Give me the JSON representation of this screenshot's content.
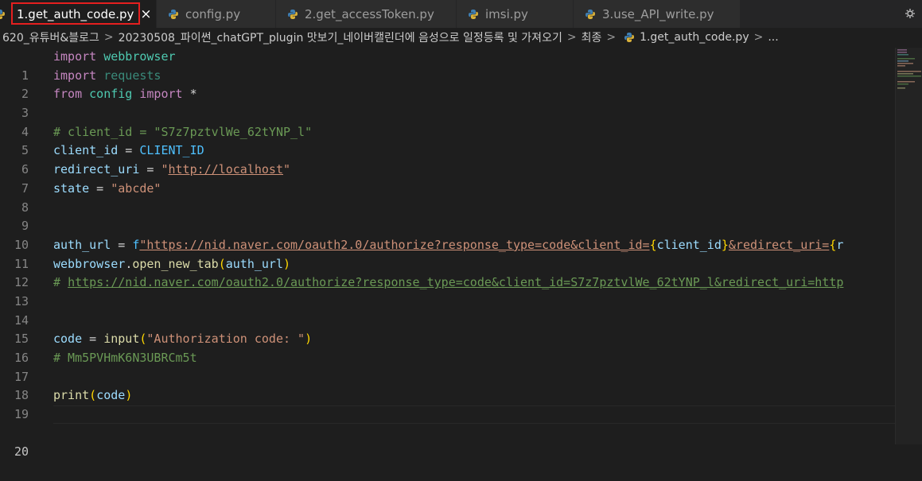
{
  "colors": {
    "background": "#1e1e1e",
    "tab_active_outline": "#e51f1f",
    "python_blue": "#3f7fb3",
    "python_yellow": "#d9b13a"
  },
  "tabs": [
    {
      "label": "1.get_auth_code.py",
      "icon": "python-icon",
      "active": true,
      "close": "×"
    },
    {
      "label": "config.py",
      "icon": "python-icon"
    },
    {
      "label": "2.get_accessToken.py",
      "icon": "python-icon"
    },
    {
      "label": "imsi.py",
      "icon": "python-icon"
    },
    {
      "label": "3.use_API_write.py",
      "icon": "python-icon"
    }
  ],
  "tabbar_action_icon": "settings-gear-icon",
  "breadcrumb": {
    "items": [
      "620_유튜버&블로그",
      "20230508_파이썬_chatGPT_plugin 맛보기_네이버캘린더에 음성으로 일정등록 및 가져오기",
      "최종",
      "1.get_auth_code.py",
      "..."
    ],
    "separator": ">"
  },
  "editor": {
    "current_line": 20,
    "line_numbers": [
      "1",
      "2",
      "3",
      "4",
      "5",
      "6",
      "7",
      "8",
      "9",
      "10",
      "11",
      "12",
      "13",
      "14",
      "15",
      "16",
      "17",
      "18",
      "19",
      "20"
    ],
    "code": {
      "l1": {
        "kw": "import",
        "mod": "webbrowser"
      },
      "l2": {
        "kw": "import",
        "mod": "requests"
      },
      "l3": {
        "kw_from": "from",
        "mod": "config",
        "kw_import": "import",
        "star": "*"
      },
      "l5": {
        "comment": "# client_id = \"S7z7pztvlWe_62tYNP_l\""
      },
      "l6": {
        "var": "client_id",
        "eq": " = ",
        "const": "CLIENT_ID"
      },
      "l7": {
        "var": "redirect_uri",
        "eq": " = ",
        "q1": "\"",
        "url": "http://localhost",
        "q2": "\""
      },
      "l8": {
        "var": "state",
        "eq": " = ",
        "str": "\"abcde\""
      },
      "l11": {
        "var": "auth_url",
        "eq": " = ",
        "prefix": "f",
        "s1": "\"https://nid.naver.com/oauth2.0/authorize?response_type=code&client_id=",
        "b1": "{",
        "v1": "client_id",
        "b2": "}",
        "s2": "&redirect_uri=",
        "b3": "{",
        "v2": "r"
      },
      "l12": {
        "obj": "webbrowser",
        "dot": ".",
        "fn": "open_new_tab",
        "p1": "(",
        "arg": "auth_url",
        "p2": ")"
      },
      "l13": {
        "hash": "# ",
        "url": "https://nid.naver.com/oauth2.0/authorize?response_type=code&client_id=S7z7pztvlWe_62tYNP_l&redirect_uri=http"
      },
      "l16": {
        "var": "code",
        "eq": " = ",
        "fn": "input",
        "p1": "(",
        "str": "\"Authorization code: \"",
        "p2": ")"
      },
      "l17": {
        "comment": "# Mm5PVHmK6N3UBRCm5t"
      },
      "l19": {
        "fn": "print",
        "p1": "(",
        "arg": "code",
        "p2": ")"
      }
    }
  }
}
